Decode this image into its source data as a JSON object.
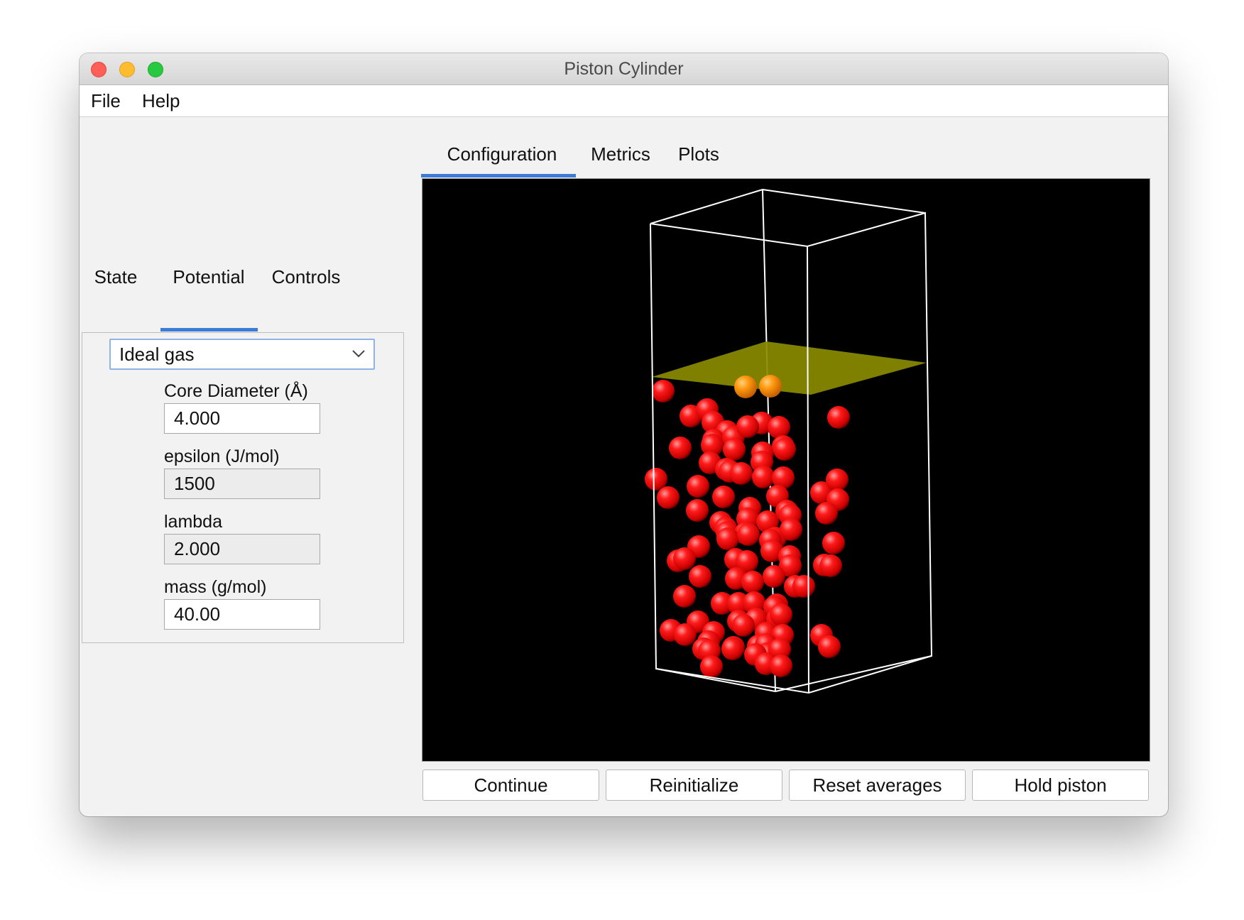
{
  "window": {
    "title": "Piston Cylinder"
  },
  "menubar": {
    "items": [
      "File",
      "Help"
    ]
  },
  "left_tabs": {
    "items": [
      "State",
      "Potential",
      "Controls"
    ],
    "selected": "Potential"
  },
  "potential": {
    "type_selected": "Ideal gas",
    "fields": [
      {
        "label": "Core Diameter (Å)",
        "value": "4.000",
        "editable": true
      },
      {
        "label": "epsilon (J/mol)",
        "value": "1500",
        "editable": false
      },
      {
        "label": "lambda",
        "value": "2.000",
        "editable": false
      },
      {
        "label": "mass (g/mol)",
        "value": "40.00",
        "editable": true
      }
    ]
  },
  "right_tabs": {
    "items": [
      "Configuration",
      "Metrics",
      "Plots"
    ],
    "selected": "Configuration"
  },
  "buttons": [
    "Continue",
    "Reinitialize",
    "Reset averages",
    "Hold piston"
  ],
  "colors": {
    "accent": "#3d7bd6",
    "viewport_background": "#000000",
    "atom": "#ff0000",
    "piston_atom": "#ff8c00",
    "piston_plane": "#8a8a00",
    "box_edges": "#ffffff"
  },
  "scene": {
    "atom_count_visible": 107
  }
}
